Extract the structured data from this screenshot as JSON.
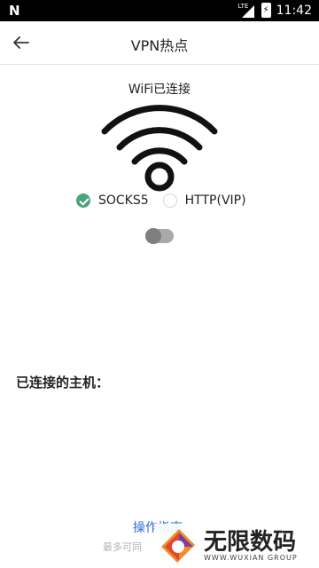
{
  "status_bar": {
    "carrier_icon": "N",
    "network_label": "LTE",
    "time": "11:42"
  },
  "app_bar": {
    "title": "VPN热点"
  },
  "wifi": {
    "status": "WiFi已连接"
  },
  "protocols": [
    {
      "label": "SOCKS5",
      "selected": true
    },
    {
      "label": "HTTP(VIP)",
      "selected": false
    }
  ],
  "toggle": {
    "on": false
  },
  "hosts": {
    "heading": "已连接的主机："
  },
  "footer": {
    "guide_link": "操作指南",
    "hint": "最多可同"
  },
  "watermark": {
    "brand_cn": "无限数码",
    "brand_en": "WWW.WUXIAN GROUP"
  },
  "colors": {
    "accent_green": "#4ea27a",
    "link_blue": "#2f6ccf",
    "status_bar": "#000000"
  }
}
